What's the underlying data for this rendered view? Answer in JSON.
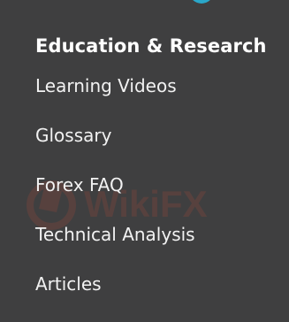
{
  "menu": {
    "title": "Education & Research",
    "items": [
      {
        "label": "Learning Videos"
      },
      {
        "label": "Glossary"
      },
      {
        "label": "Forex FAQ"
      },
      {
        "label": "Technical Analysis"
      },
      {
        "label": "Articles"
      }
    ]
  },
  "colors": {
    "background": "#3f3f40",
    "text": "#f2f2f2",
    "accent": "#2aa7c9"
  },
  "watermark": {
    "text": "WikiFX",
    "icon": "wikifx-logo-icon"
  }
}
